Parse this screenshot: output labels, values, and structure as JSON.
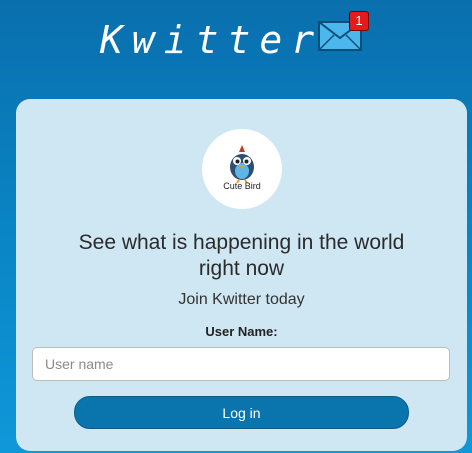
{
  "header": {
    "app_title": "Kwitter",
    "mail_icon": "envelope-icon",
    "notification_count": "1",
    "colors": {
      "badge": "#e21b1b",
      "envelope": "#4bb7ec"
    }
  },
  "card": {
    "logo_text": "Cute Bird",
    "headline_line1": "See what is happening in the world",
    "headline_line2": "right now",
    "subheadline": "Join Kwitter today",
    "username_label": "User Name:",
    "username_value": "",
    "username_placeholder": "User name",
    "login_label": "Log in",
    "colors": {
      "card_bg": "#cfe6f3",
      "button_bg": "#0a74ad"
    }
  }
}
